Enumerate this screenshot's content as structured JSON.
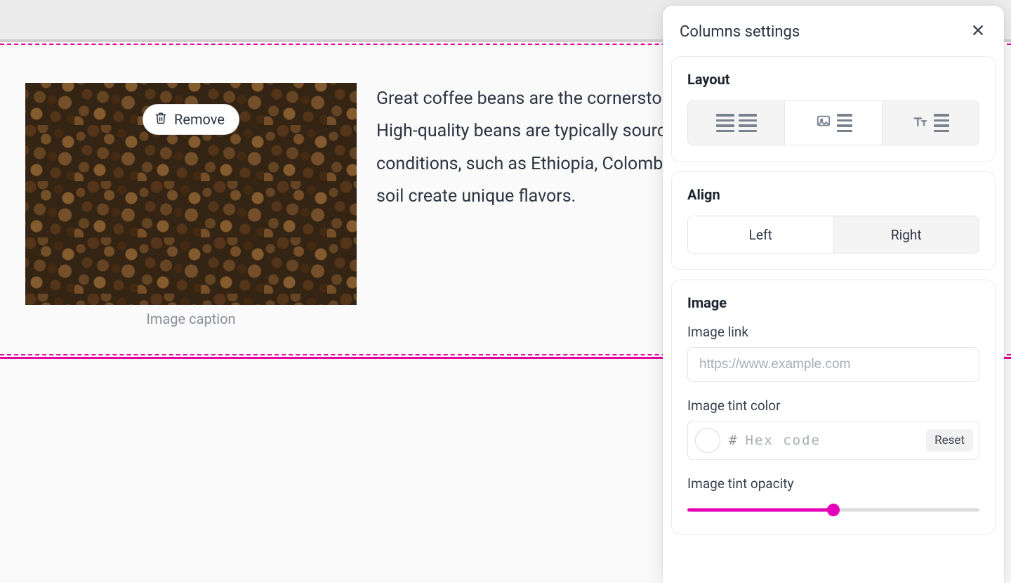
{
  "canvas": {
    "image_block": {
      "remove_label": "Remove",
      "caption_placeholder": "Image caption"
    },
    "body_text": "Great coffee beans are the cornerstone of an exceptional coffee experience. High-quality beans are typically sourced from regions with ideal growing conditions, such as Ethiopia, Colombia, and Brazil, where altitude, climate, and soil create unique flavors."
  },
  "panel": {
    "title": "Columns settings",
    "layout": {
      "title": "Layout",
      "options": [
        "text-text",
        "image-text",
        "heading-text"
      ],
      "active": 1
    },
    "align": {
      "title": "Align",
      "options": {
        "left": "Left",
        "right": "Right"
      },
      "active": "left"
    },
    "image": {
      "title": "Image",
      "link_label": "Image link",
      "link_placeholder": "https://www.example.com",
      "link_value": "",
      "tint_color_label": "Image tint color",
      "hex_prefix": "#",
      "hex_placeholder": "Hex code",
      "hex_value": "",
      "reset_label": "Reset",
      "tint_opacity_label": "Image tint opacity",
      "tint_opacity_percent": 50
    }
  },
  "colors": {
    "accent": "#e400b7",
    "selection": "#e400a0"
  }
}
